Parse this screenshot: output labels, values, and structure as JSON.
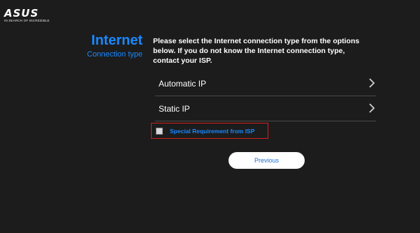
{
  "brand": {
    "logo": "ASUS",
    "tagline": "IN SEARCH OF INCREDIBLE"
  },
  "heading": {
    "title": "Internet",
    "subtitle": "Connection type"
  },
  "instructions": "Please select the Internet connection type from the options below. If you do not know the Internet connection type, contact your ISP.",
  "options": [
    {
      "label": "Automatic IP",
      "icon": "chevron-right-icon"
    },
    {
      "label": "Static IP",
      "icon": "chevron-right-icon"
    }
  ],
  "special_requirement": {
    "label": "Special Requirement from ISP",
    "checked": false,
    "highlight_color": "#d32020"
  },
  "previous_button": {
    "label": "Previous"
  },
  "colors": {
    "accent": "#1a88ff",
    "background": "#1c1c1c"
  }
}
